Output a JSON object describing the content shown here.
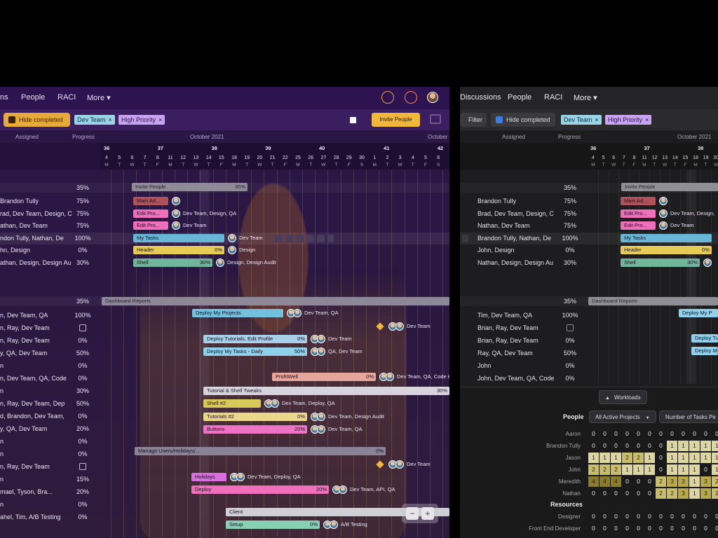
{
  "left": {
    "nav": {
      "items": [
        "ns",
        "People",
        "RACI",
        "More ▾"
      ]
    },
    "filter": {
      "hide_completed": "Hide completed",
      "chips": [
        {
          "label": "Dev Team",
          "color": "#9ad3e6"
        },
        {
          "label": "High Priority",
          "color": "#c8a3f0"
        }
      ],
      "invite": "Invite People",
      "remove": "×"
    },
    "columns": {
      "assigned": "Assigned",
      "progress": "Progress",
      "month": "October 2021",
      "month2": "October"
    },
    "weeks": [
      "36",
      "37",
      "38",
      "39",
      "40",
      "41",
      "42"
    ],
    "days": [
      "4",
      "5",
      "6",
      "7",
      "8",
      "11",
      "12",
      "13",
      "14",
      "15",
      "18",
      "19",
      "20",
      "21",
      "22",
      "25",
      "26",
      "27",
      "28",
      "29",
      "30",
      "1",
      "2",
      "3",
      "4",
      "5",
      "6"
    ],
    "day_letters": [
      "M",
      "T",
      "W",
      "T",
      "F",
      "M",
      "T",
      "W",
      "T",
      "F",
      "M",
      "T",
      "W",
      "T",
      "F",
      "M",
      "T",
      "W",
      "T",
      "F",
      "S",
      "M",
      "T",
      "W",
      "T",
      "F",
      "S"
    ],
    "section1": {
      "progress": "35%",
      "label": "Invite People",
      "pct": "35%"
    },
    "rows1": [
      {
        "assigned": "Brandon Tully",
        "progress": "75%",
        "bar": "Main Ad...",
        "barColor": "#b0525a",
        "who": ""
      },
      {
        "assigned": "rad, Dev Team, Design, C",
        "progress": "75%",
        "bar": "Edit Pro...",
        "barColor": "#ef6fbb",
        "who": "Dev Team, Design, QA"
      },
      {
        "assigned": "athan, Dev Team",
        "progress": "75%",
        "bar": "Edit Pro...",
        "barColor": "#ef6fbb",
        "who": "Dev Team"
      },
      {
        "assigned": "ndon Tully, Nathan, De",
        "progress": "100%",
        "bar": "My Tasks",
        "barColor": "#69b7d6",
        "who": "Dev Team"
      },
      {
        "assigned": "hn, Design",
        "progress": "0%",
        "bar": "Header",
        "barColor": "#e6cc55",
        "who": "Design",
        "pct": "0%"
      },
      {
        "assigned": "athan, Design, Design Au",
        "progress": "30%",
        "bar": "Shell",
        "barColor": "#6fb69a",
        "who": "Design, Design Audit",
        "pct": "30%"
      }
    ],
    "section2": {
      "progress": "35%",
      "label": "Dashboard Reports"
    },
    "rows2": [
      {
        "assigned": "n, Dev Team, QA",
        "progress": "100%"
      },
      {
        "assigned": "n, Ray, Dev Team",
        "progress": ""
      },
      {
        "assigned": "n, Ray, Dev Team",
        "progress": "0%"
      },
      {
        "assigned": "y, QA, Dev Team",
        "progress": "50%"
      },
      {
        "assigned": "n",
        "progress": "0%"
      },
      {
        "assigned": "n, Dev Team, QA, Code",
        "progress": "0%"
      },
      {
        "assigned": "n",
        "progress": "30%"
      },
      {
        "assigned": "n, Ray, Dev Team, Dep",
        "progress": "50%"
      },
      {
        "assigned": "d, Brandon, Dev Team,",
        "progress": "0%"
      },
      {
        "assigned": "y, QA, Dev Team",
        "progress": "20%"
      },
      {
        "assigned": "n",
        "progress": "0%"
      },
      {
        "assigned": "n",
        "progress": "0%"
      },
      {
        "assigned": "n, Ray, Dev Team",
        "progress": ""
      },
      {
        "assigned": "n",
        "progress": "15%"
      },
      {
        "assigned": "mael, Tyson, Bra...",
        "progress": "20%"
      },
      {
        "assigned": "n",
        "progress": "0%"
      },
      {
        "assigned": "ahel, Tim, A/B Testing",
        "progress": "0%"
      }
    ],
    "gantt2": [
      {
        "bar": "Deploy My Projects",
        "color": "#74c1dd",
        "who": "Dev Team, QA"
      },
      {
        "bar": "",
        "color": "",
        "who": "Dev Team"
      },
      {
        "bar": "Deploy Tutorials, Edit Profile",
        "color": "#a9cfe9",
        "who": "Dev Team",
        "pct": "0%"
      },
      {
        "bar": "Deploy My Tasks - Daily",
        "color": "#8fd0ea",
        "who": "QA, Dev Team",
        "pct": "50%"
      },
      {
        "bar": "ProfitWell",
        "color": "#e7a69a",
        "who": "Dev Team, QA, Code H",
        "pct": "0%"
      },
      {
        "bar": "Tutorial & Shell Tweaks",
        "color": "#d8d4de",
        "pct": "30%"
      },
      {
        "bar": "Shell #2",
        "color": "#d9c85a",
        "who": "Dev Team, Deploy, QA"
      },
      {
        "bar": "Tutorials #2",
        "color": "#ead78a",
        "who": "Dev Team, Design Audit",
        "pct": "0%"
      },
      {
        "bar": "Buttons",
        "color": "#ef73c4",
        "who": "Dev Team, QA",
        "pct": "20%"
      },
      {
        "bar": "Manage Users/Holidays/...",
        "color": "#8a8296",
        "pct": "0%"
      },
      {
        "bar": "",
        "color": "",
        "who": "Dev Team"
      },
      {
        "bar": "Holidays",
        "color": "#d96fde",
        "who": "Dev Team, Deploy, QA"
      },
      {
        "bar": "Deploy",
        "color": "#ef6fbb",
        "who": "Dev Team, API, QA",
        "pct": "20%"
      },
      {
        "bar": "Client",
        "color": "#cfcfd6"
      },
      {
        "bar": "Setup",
        "color": "#88d0b4",
        "who": "A/B Testing",
        "pct": "0%"
      }
    ],
    "zoom": {
      "minus": "−",
      "plus": "+"
    }
  },
  "right": {
    "nav": {
      "items": [
        "Discussions",
        "People",
        "RACI",
        "More ▾"
      ]
    },
    "filter": {
      "filter": "Filter",
      "hide_completed": "Hide completed",
      "chips": [
        {
          "label": "Dev Team",
          "color": "#9ad3e6"
        },
        {
          "label": "High Priority",
          "color": "#c8a3f0"
        }
      ],
      "remove": "×"
    },
    "columns": {
      "assigned": "Assigned",
      "progress": "Progress",
      "month": "October 2021"
    },
    "weeks": [
      "36",
      "37",
      "38"
    ],
    "days": [
      "4",
      "5",
      "6",
      "7",
      "8",
      "11",
      "12",
      "13",
      "14",
      "15",
      "18",
      "19",
      "20"
    ],
    "day_letters": [
      "M",
      "T",
      "W",
      "T",
      "F",
      "M",
      "T",
      "W",
      "T",
      "F",
      "M",
      "T",
      "W"
    ],
    "section1": {
      "progress": "35%",
      "label": "Invite People"
    },
    "rows1": [
      {
        "assigned": "Brandon Tully",
        "progress": "75%",
        "bar": "Main Ad...",
        "barColor": "#b0525a",
        "who": ""
      },
      {
        "assigned": "Brad, Dev Team, Design, C",
        "progress": "75%",
        "bar": "Edit Pro...",
        "barColor": "#ef6fbb",
        "who": "Dev Team, Design,"
      },
      {
        "assigned": "Nathan, Dev Team",
        "progress": "75%",
        "bar": "Edit Pro...",
        "barColor": "#ef6fbb",
        "who": "Dev Team"
      },
      {
        "assigned": "Brandon Tully, Nathan, De",
        "progress": "100%",
        "bar": "My Tasks",
        "barColor": "#69b7d6",
        "who": ""
      },
      {
        "assigned": "John, Design",
        "progress": "0%",
        "bar": "Header",
        "barColor": "#e6cc55",
        "who": "",
        "pct": "0%"
      },
      {
        "assigned": "Nathan, Design, Design Au",
        "progress": "30%",
        "bar": "Shell",
        "barColor": "#6fb69a",
        "who": "",
        "pct": "30%"
      }
    ],
    "section2": {
      "progress": "35%",
      "label": "Dashboard Reports"
    },
    "rows2": [
      {
        "assigned": "Tim, Dev Team, QA",
        "progress": "100%",
        "bar": "Deploy My P"
      },
      {
        "assigned": "Brian, Ray, Dev Team",
        "progress": "",
        "bar": ""
      },
      {
        "assigned": "Brian, Ray, Dev Team",
        "progress": "0%",
        "bar": "Deploy Tutori"
      },
      {
        "assigned": "Ray, QA, Dev Team",
        "progress": "50%",
        "bar": "Deploy My"
      },
      {
        "assigned": "John",
        "progress": "0%",
        "bar": ""
      },
      {
        "assigned": "John, Dev Team, QA, Code",
        "progress": "0%",
        "bar": ""
      }
    ],
    "workloads": {
      "button": "Workloads",
      "people_label": "People",
      "filter1": "All Active Projects",
      "filter2": "Number of Tasks Pe",
      "resources_label": "Resources",
      "people": [
        {
          "name": "Aaron",
          "cells": [
            "0",
            "0",
            "0",
            "0",
            "0",
            "0",
            "0",
            "0",
            "0",
            "0",
            "0",
            "0"
          ]
        },
        {
          "name": "Brandon Tully",
          "cells": [
            "0",
            "0",
            "0",
            "0",
            "0",
            "0",
            "0",
            "1",
            "1",
            "1",
            "1",
            "1"
          ]
        },
        {
          "name": "Jason",
          "cells": [
            "1",
            "1",
            "1",
            "2",
            "2",
            "1",
            "0",
            "1",
            "1",
            "1",
            "1",
            "1"
          ]
        },
        {
          "name": "John",
          "cells": [
            "2",
            "2",
            "2",
            "1",
            "1",
            "1",
            "0",
            "1",
            "1",
            "1",
            "0",
            "1"
          ]
        },
        {
          "name": "Meredith",
          "cells": [
            "4",
            "4",
            "4",
            "0",
            "0",
            "0",
            "2",
            "3",
            "3",
            "1",
            "3",
            "2"
          ]
        },
        {
          "name": "Nathan",
          "cells": [
            "0",
            "0",
            "0",
            "0",
            "0",
            "0",
            "2",
            "2",
            "3",
            "1",
            "3",
            "2"
          ]
        }
      ],
      "resources": [
        {
          "name": "Designer",
          "cells": [
            "0",
            "0",
            "0",
            "0",
            "0",
            "0",
            "0",
            "0",
            "0",
            "0",
            "0",
            "0"
          ]
        },
        {
          "name": "Front End Developer",
          "cells": [
            "0",
            "0",
            "0",
            "0",
            "0",
            "0",
            "0",
            "0",
            "0",
            "0",
            "0",
            "0"
          ]
        }
      ]
    }
  }
}
